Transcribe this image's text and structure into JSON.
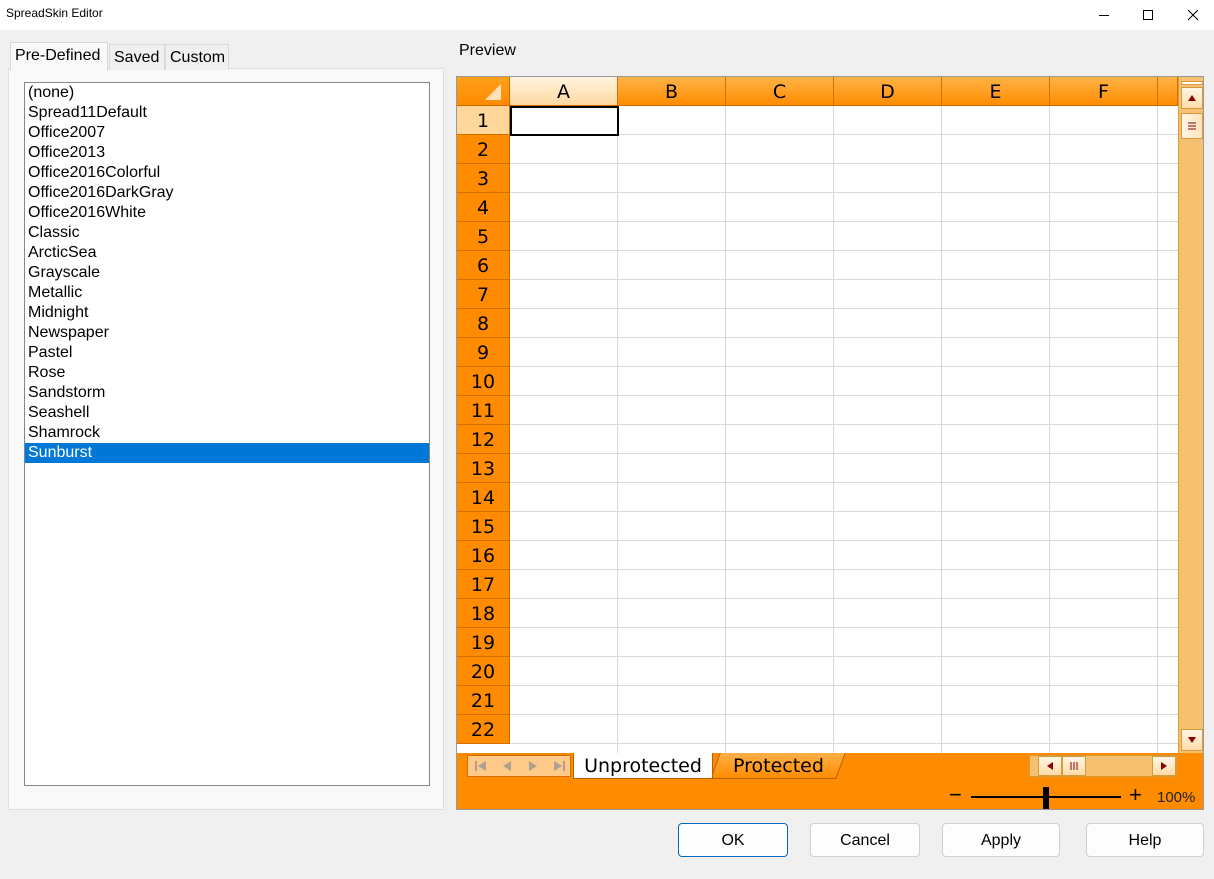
{
  "window": {
    "title": "SpreadSkin Editor"
  },
  "tabs": [
    {
      "label": "Pre-Defined",
      "active": true
    },
    {
      "label": "Saved",
      "active": false
    },
    {
      "label": "Custom",
      "active": false
    }
  ],
  "skins": {
    "items": [
      "(none)",
      "Spread11Default",
      "Office2007",
      "Office2013",
      "Office2016Colorful",
      "Office2016DarkGray",
      "Office2016White",
      "Classic",
      "ArcticSea",
      "Grayscale",
      "Metallic",
      "Midnight",
      "Newspaper",
      "Pastel",
      "Rose",
      "Sandstorm",
      "Seashell",
      "Shamrock",
      "Sunburst"
    ],
    "selected": "Sunburst"
  },
  "preview": {
    "label": "Preview",
    "columns": [
      "A",
      "B",
      "C",
      "D",
      "E",
      "F"
    ],
    "rows": [
      "1",
      "2",
      "3",
      "4",
      "5",
      "6",
      "7",
      "8",
      "9",
      "10",
      "11",
      "12",
      "13",
      "14",
      "15",
      "16",
      "17",
      "18",
      "19",
      "20",
      "21",
      "22"
    ],
    "active_cell": "A1",
    "sheet_tabs": [
      {
        "label": "Unprotected",
        "active": true
      },
      {
        "label": "Protected",
        "active": false
      }
    ],
    "zoom": {
      "minus": "−",
      "plus": "+",
      "value": "100%"
    },
    "colors": {
      "header": "#ff8c00",
      "active_header": "#ffd79a",
      "scrollbar": "#f5c070"
    }
  },
  "buttons": {
    "ok": "OK",
    "cancel": "Cancel",
    "apply": "Apply",
    "help": "Help"
  }
}
